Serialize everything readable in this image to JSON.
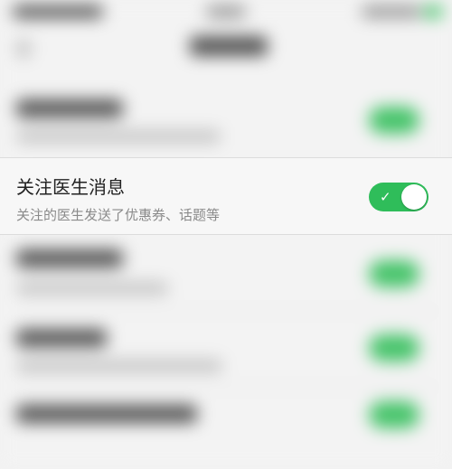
{
  "setting": {
    "title": "关注医生消息",
    "subtitle": "关注的医生发送了优惠券、话题等",
    "toggle_state": "on",
    "toggle_check_icon": "✓"
  },
  "colors": {
    "toggle_on": "#2fbd5a",
    "background": "#f2f2f2"
  }
}
